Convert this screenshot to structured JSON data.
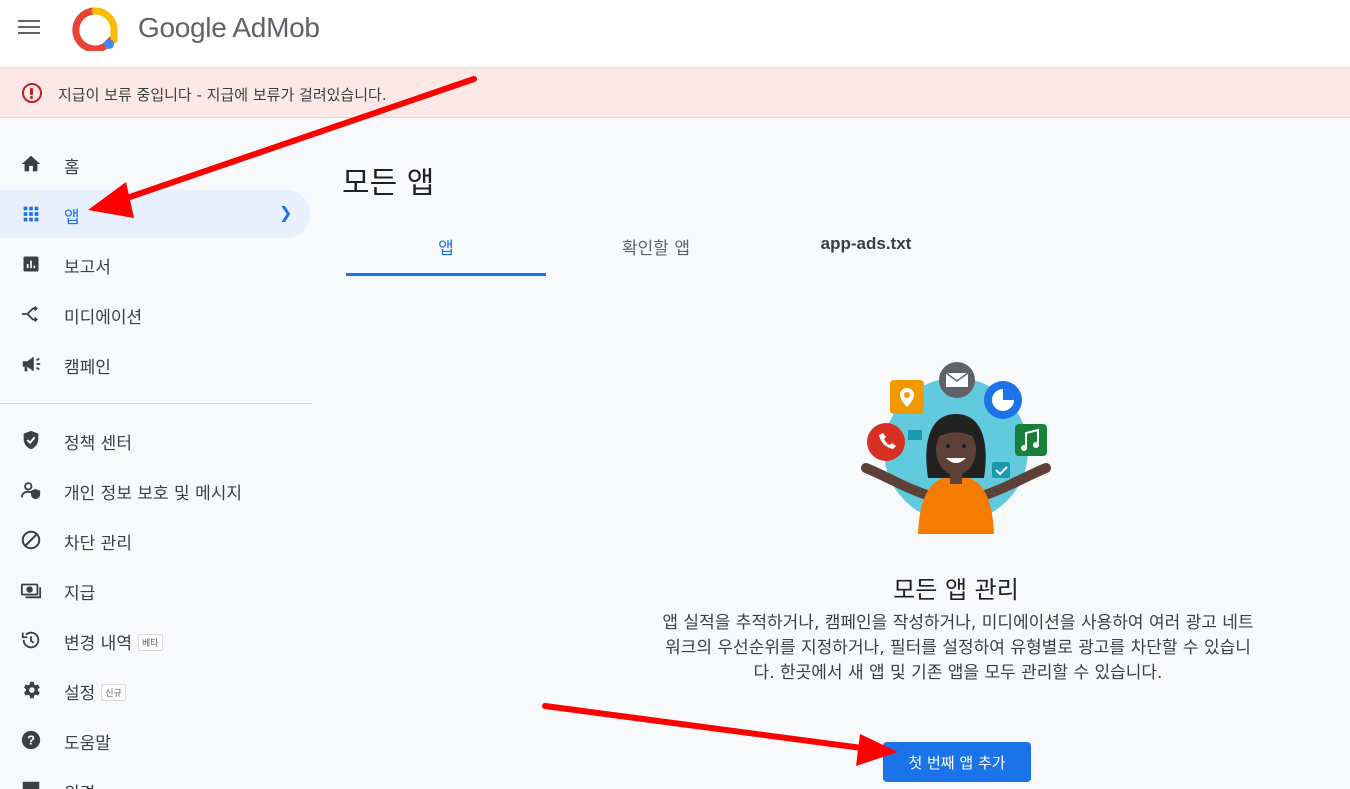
{
  "header": {
    "brand": "Google AdMob",
    "menu_icon": "hamburger-menu-icon",
    "logo_icon": "admob-logo-icon"
  },
  "alert": {
    "icon": "error-circle-icon",
    "text": "지급이 보류 중입니다 - 지급에 보류가 걸려있습니다."
  },
  "sidebar": {
    "items": [
      {
        "label": "홈",
        "icon": "home-icon"
      },
      {
        "label": "앱",
        "icon": "apps-grid-icon",
        "active": true
      },
      {
        "label": "보고서",
        "icon": "bar-chart-icon"
      },
      {
        "label": "미디에이션",
        "icon": "call-split-icon"
      },
      {
        "label": "캠페인",
        "icon": "megaphone-icon"
      },
      {
        "label": "정책 센터",
        "icon": "shield-check-icon"
      },
      {
        "label": "개인 정보 보호 및 메시지",
        "icon": "person-shield-icon"
      },
      {
        "label": "차단 관리",
        "icon": "block-icon"
      },
      {
        "label": "지급",
        "icon": "payments-icon"
      },
      {
        "label": "변경 내역",
        "icon": "history-icon",
        "badge": "베타"
      },
      {
        "label": "설정",
        "icon": "gear-icon",
        "badge": "신규"
      },
      {
        "label": "도움말",
        "icon": "help-icon"
      },
      {
        "label": "의견",
        "icon": "feedback-icon"
      }
    ]
  },
  "main": {
    "title": "모든 앱",
    "tabs": [
      {
        "label": "앱",
        "active": true
      },
      {
        "label": "확인할 앱"
      },
      {
        "label": "app-ads.txt"
      }
    ],
    "empty_state": {
      "title": "모든 앱 관리",
      "description": "앱 실적을 추적하거나, 캠페인을 작성하거나, 미디에이션을 사용하여 여러 광고 네트워크의 우선순위를 지정하거나, 필터를 설정하여 유형별로 광고를 차단할 수 있습니다. 한곳에서 새 앱 및 기존 앱을 모두 관리할 수 있습니다.",
      "button": "첫 번째 앱 추가"
    }
  },
  "colors": {
    "accent": "#1a73e8",
    "alert_bg": "#fce8e6",
    "annotation_arrow": "#ff0000"
  }
}
